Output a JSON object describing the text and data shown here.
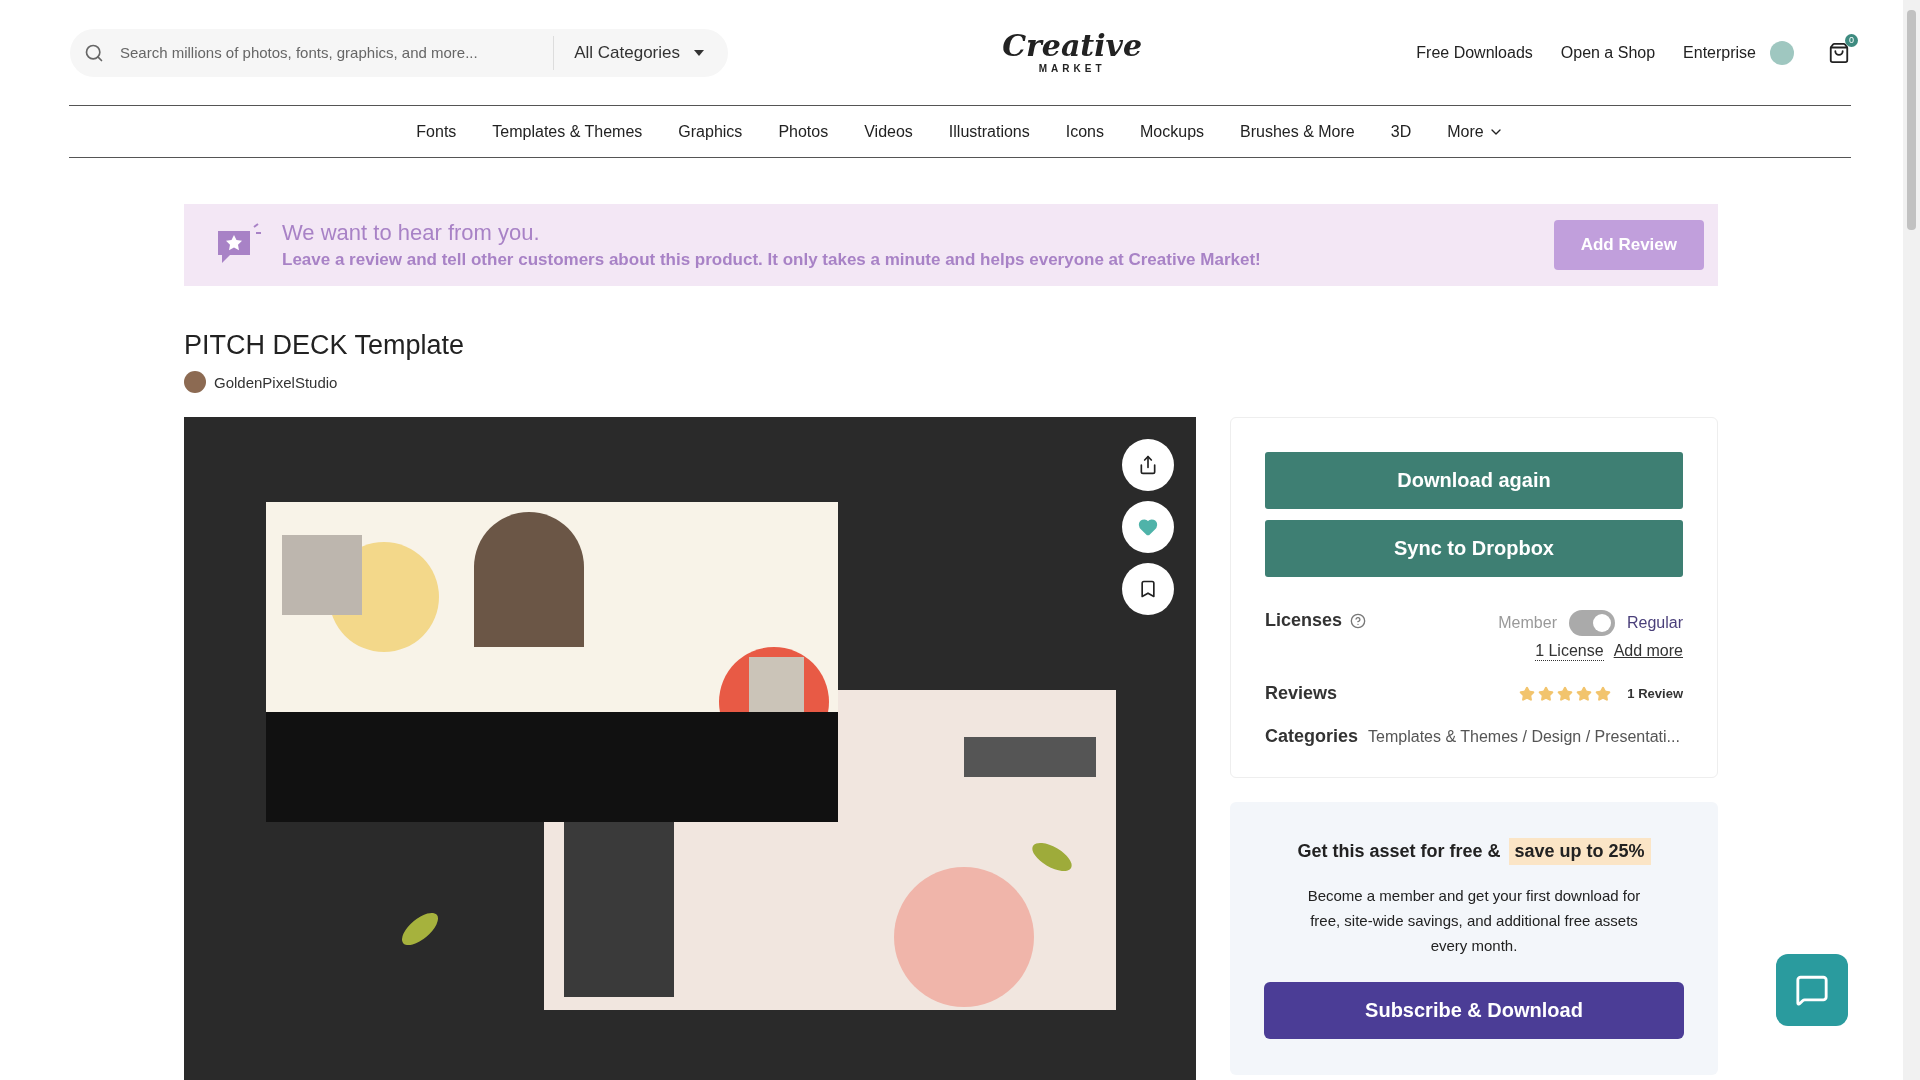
{
  "search": {
    "placeholder": "Search millions of photos, fonts, graphics, and more...",
    "category": "All Categories"
  },
  "logo": {
    "title": "Creative",
    "subtitle": "MARKET"
  },
  "top_links": [
    "Free Downloads",
    "Open a Shop",
    "Enterprise"
  ],
  "cart": {
    "count": "0"
  },
  "nav": [
    {
      "label": "Fonts",
      "caret": false
    },
    {
      "label": "Templates & Themes",
      "caret": false
    },
    {
      "label": "Graphics",
      "caret": false
    },
    {
      "label": "Photos",
      "caret": false
    },
    {
      "label": "Videos",
      "caret": false
    },
    {
      "label": "Illustrations",
      "caret": false
    },
    {
      "label": "Icons",
      "caret": false
    },
    {
      "label": "Mockups",
      "caret": false
    },
    {
      "label": "Brushes & More",
      "caret": false
    },
    {
      "label": "3D",
      "caret": false
    },
    {
      "label": "More",
      "caret": true
    }
  ],
  "review_banner": {
    "title": "We want to hear from you.",
    "text": "Leave a review and tell other customers about this product. It only takes a minute and helps everyone at Creative Market!",
    "button": "Add Review"
  },
  "product": {
    "title": "PITCH DECK Template",
    "author": "GoldenPixelStudio",
    "preview": {
      "kind": "picture",
      "favorited": true
    }
  },
  "actions": [
    "Download again",
    "Sync to Dropbox"
  ],
  "licenses": {
    "label": "Licenses",
    "off_label": "Member",
    "on_label": "Regular",
    "on": true,
    "count": "1 License",
    "add": "Add more"
  },
  "reviews": {
    "label": "Reviews",
    "stars": 5,
    "count": "1 Review"
  },
  "categories": {
    "label": "Categories",
    "value": "Templates & Themes / Design / Presentati..."
  },
  "membership": {
    "title": "Get this asset for free &",
    "highlight": "save up to 25%",
    "text": "Become a member and get your first download for free, site-wide savings, and additional free assets every month.",
    "button": "Subscribe & Download"
  }
}
